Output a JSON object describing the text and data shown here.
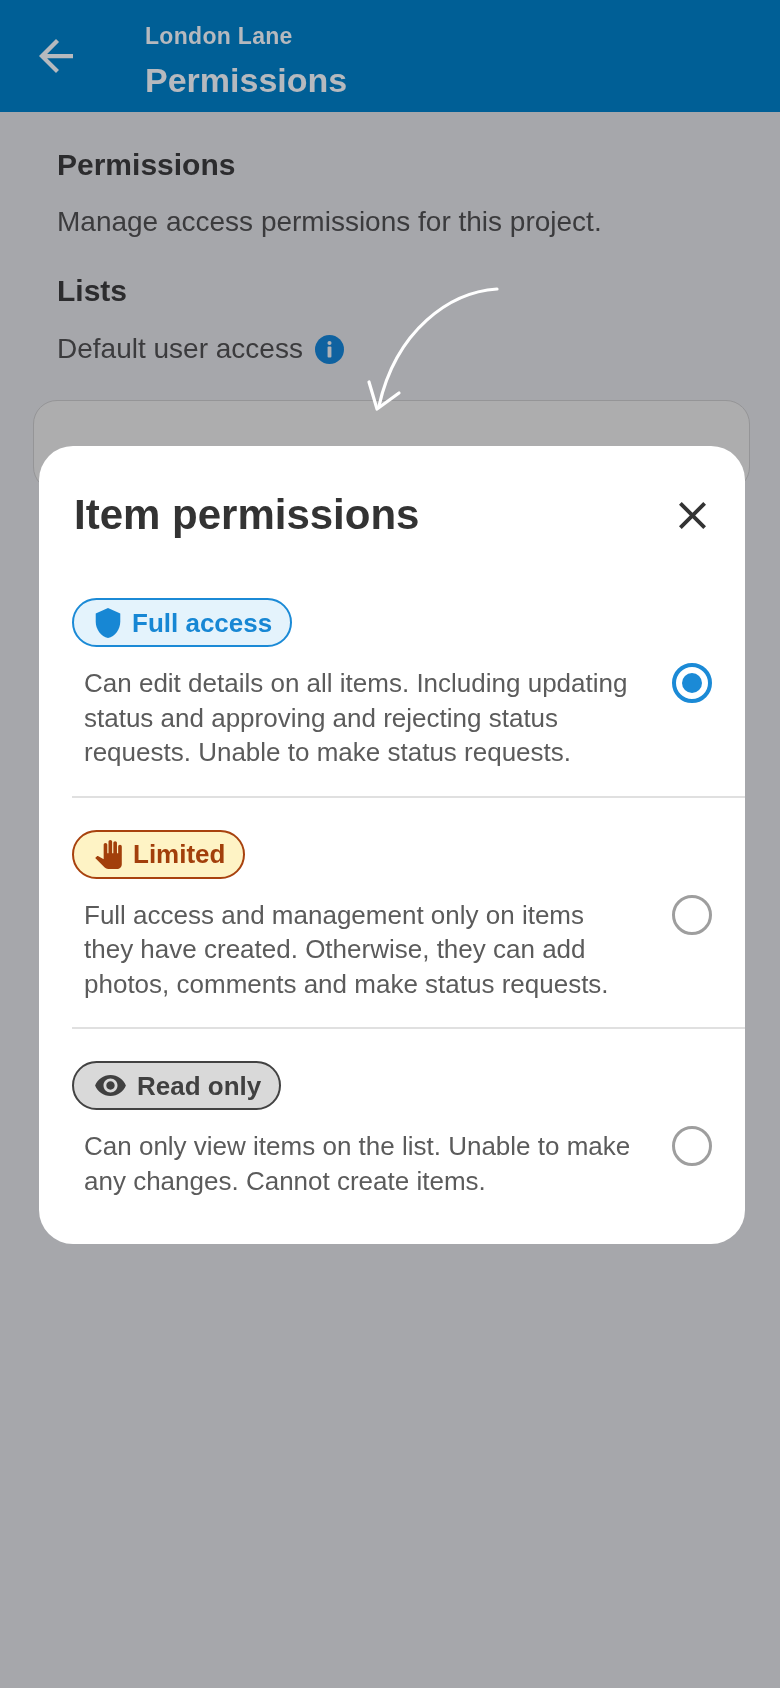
{
  "app_bar": {
    "subtitle": "London Lane",
    "title": "Permissions"
  },
  "page": {
    "heading": "Permissions",
    "description": "Manage access permissions for this project.",
    "section_title": "Lists",
    "field_label": "Default user access"
  },
  "dialog": {
    "title": "Item permissions",
    "options": [
      {
        "kind": "full",
        "label": "Full access",
        "description": "Can edit details on all items. Including updating status and approving and rejecting status requests. Unable to make status requests.",
        "selected": true
      },
      {
        "kind": "limited",
        "label": "Limited",
        "description": "Full access and management only on items they have created. Otherwise, they can add photos, comments and make status requests.",
        "selected": false
      },
      {
        "kind": "read_only",
        "label": "Read only",
        "description": "Can only view items on the list. Unable to make any changes. Cannot create items.",
        "selected": false
      }
    ]
  }
}
